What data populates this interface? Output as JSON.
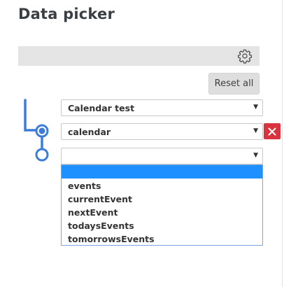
{
  "title": "Data picker",
  "search": {
    "icon": "gear-icon"
  },
  "reset_button": {
    "label": "Reset all"
  },
  "selects": [
    {
      "value": "Calendar test"
    },
    {
      "value": "calendar"
    },
    {
      "value": ""
    }
  ],
  "dropdown": {
    "options": [
      "",
      "events",
      "currentEvent",
      "nextEvent",
      "todaysEvents",
      "tomorrowsEvents"
    ],
    "highlighted_index": 0
  },
  "colors": {
    "accent": "#3b7dd8",
    "remove": "#d9333f",
    "highlight": "#1e90ff",
    "tree_line": "#3b7dd8"
  },
  "arrow_glyph": "▼"
}
